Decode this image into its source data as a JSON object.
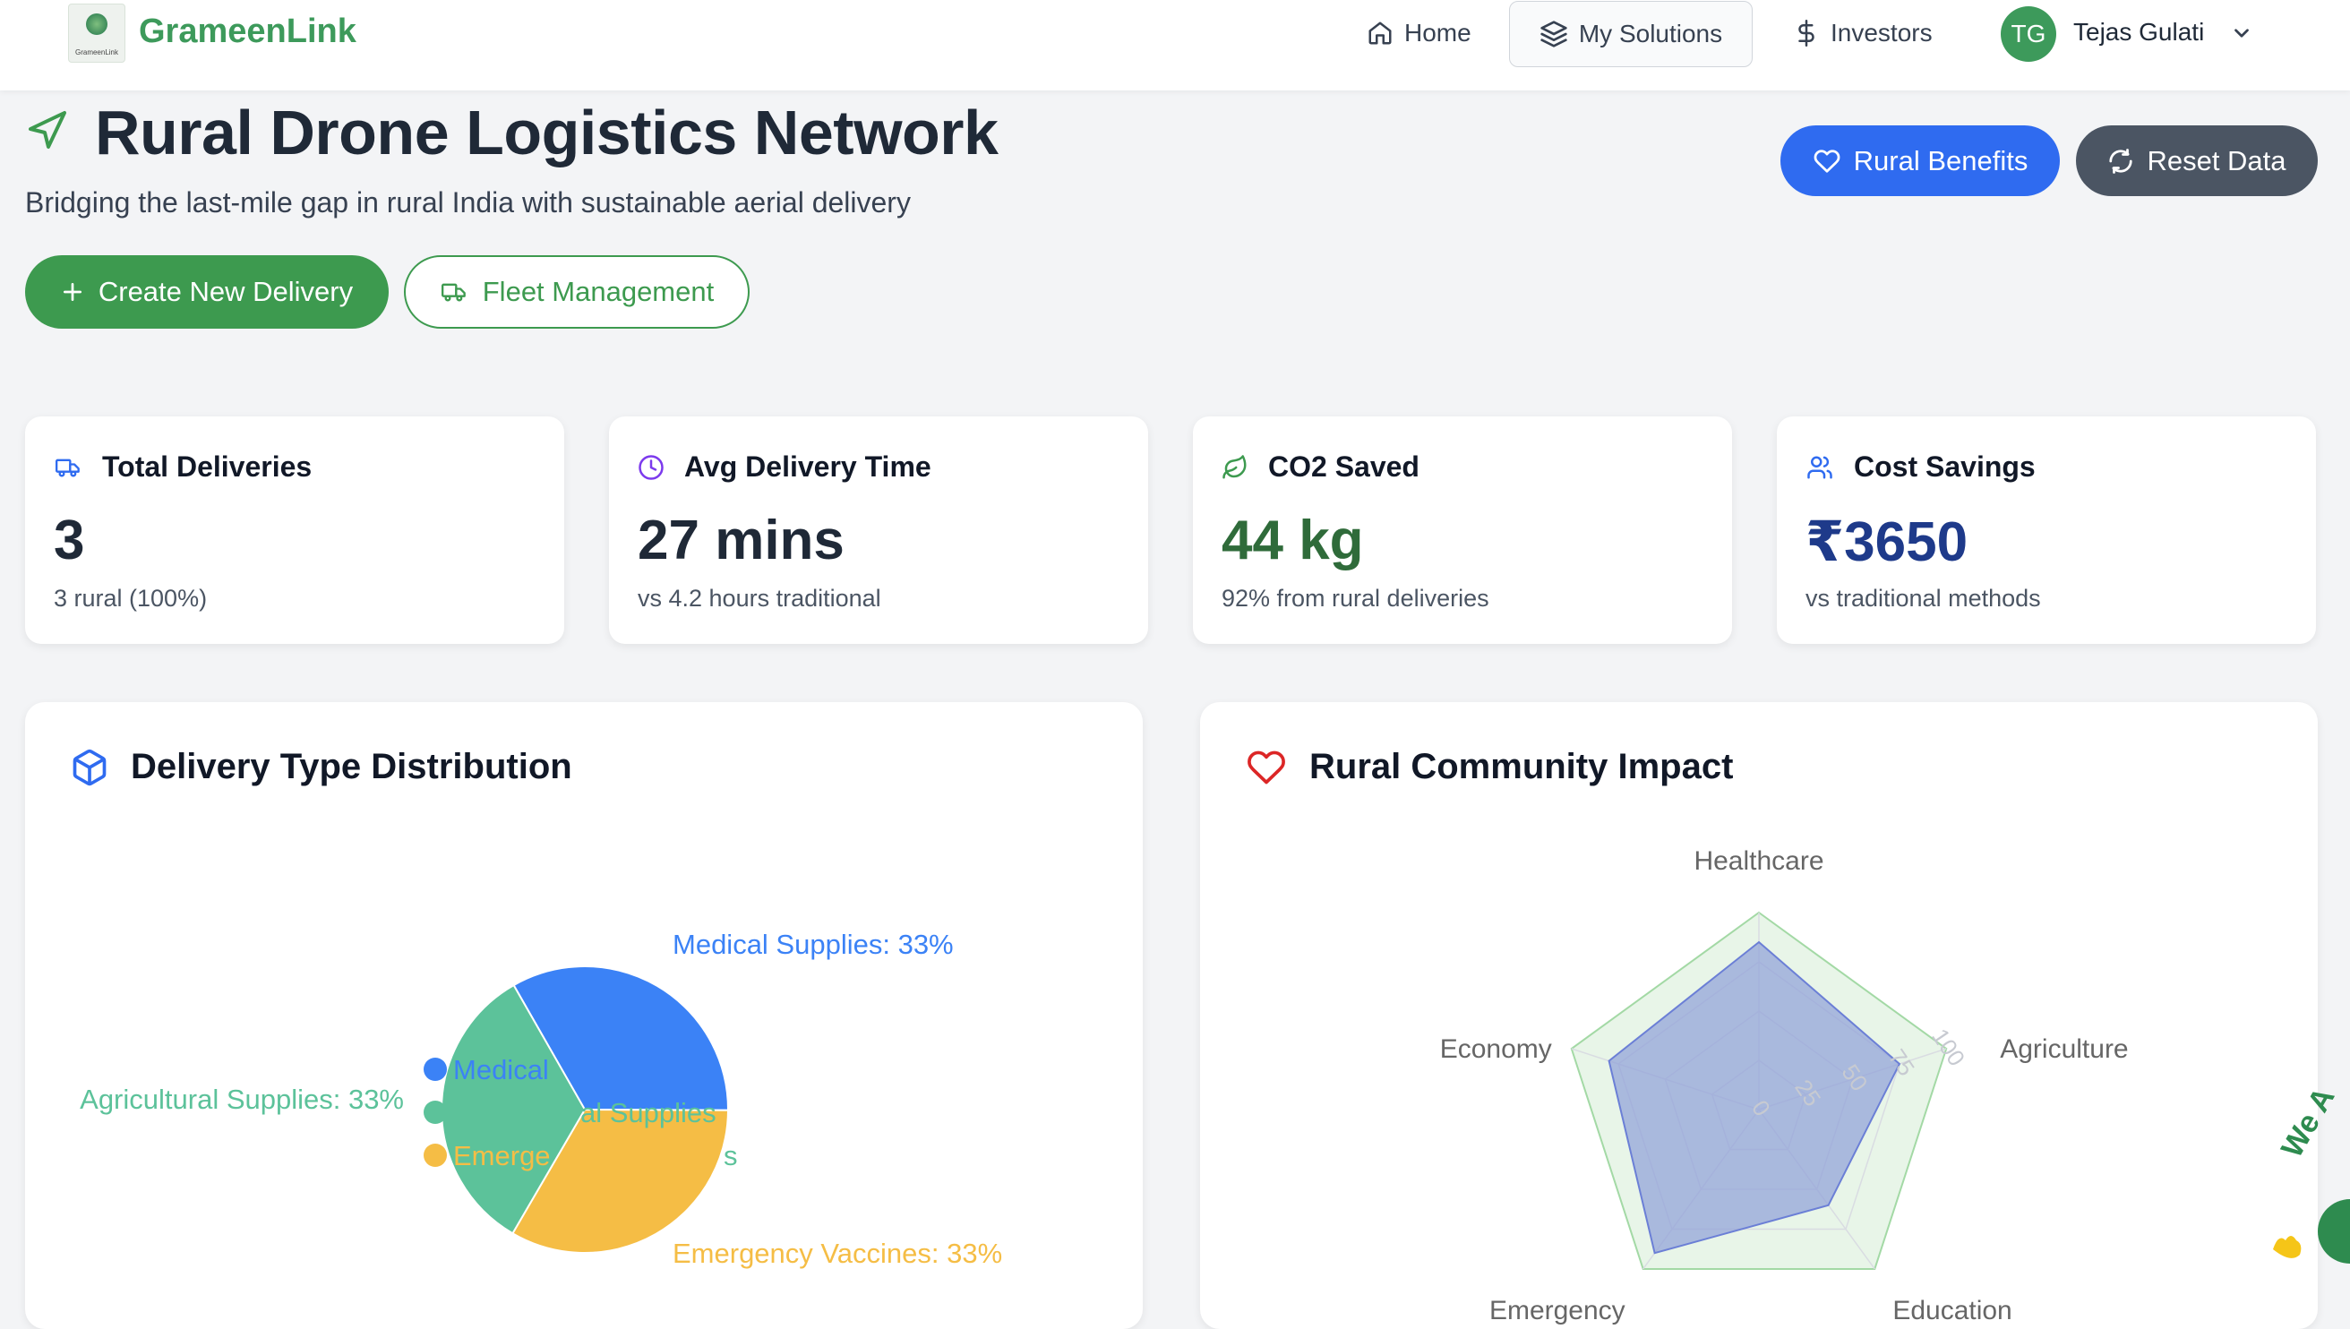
{
  "header": {
    "brand": "GrameenLink",
    "logo_caption": "GrameenLink",
    "nav": [
      {
        "label": "Home",
        "icon": "home-icon"
      },
      {
        "label": "My Solutions",
        "icon": "layers-icon"
      },
      {
        "label": "Investors",
        "icon": "dollar-icon"
      }
    ],
    "user": {
      "initials": "TG",
      "name": "Tejas Gulati"
    }
  },
  "page": {
    "title": "Rural Drone Logistics Network",
    "subtitle": "Bridging the last-mile gap in rural India with sustainable aerial delivery",
    "actions": {
      "create_delivery": "Create New Delivery",
      "fleet_management": "Fleet Management",
      "rural_benefits": "Rural Benefits",
      "reset_data": "Reset Data"
    }
  },
  "stats": [
    {
      "title": "Total Deliveries",
      "value": "3",
      "sub": "3 rural (100%)",
      "icon": "truck-icon",
      "color": "#1f2937",
      "icon_color": "#2f6bf0"
    },
    {
      "title": "Avg Delivery Time",
      "value": "27 mins",
      "sub": "vs 4.2 hours traditional",
      "icon": "clock-icon",
      "color": "#1f2937",
      "icon_color": "#7c3aed"
    },
    {
      "title": "CO2 Saved",
      "value": "44 kg",
      "sub": "92% from rural deliveries",
      "icon": "leaf-icon",
      "color": "#2f6b3a",
      "icon_color": "#3d9a4f"
    },
    {
      "title": "Cost Savings",
      "value": "₹3650",
      "sub": "vs traditional methods",
      "icon": "users-icon",
      "color": "#1e3a8a",
      "icon_color": "#2f6bf0"
    }
  ],
  "panels": {
    "distribution_title": "Delivery Type Distribution",
    "impact_title": "Rural Community Impact"
  },
  "colors": {
    "green": "#3d9a4f",
    "blue": "#2f6bf0",
    "pie_blue": "#3b82f6",
    "pie_teal": "#5cc29a",
    "pie_yellow": "#f5bd45",
    "radar_fill": "#8f9fd8",
    "radar_outer": "#a3d9a5"
  },
  "chart_data": [
    {
      "type": "pie",
      "title": "",
      "slices": [
        {
          "label": "Medical Supplies",
          "value": 33,
          "color": "#3b82f6"
        },
        {
          "label": "Emergency Vaccines",
          "value": 33,
          "color": "#f5bd45"
        },
        {
          "label": "Agricultural Supplies",
          "value": 33,
          "color": "#5cc29a"
        }
      ],
      "data_labels": [
        "Medical Supplies: 33%",
        "Emergency Vaccines: 33%",
        "Agricultural Supplies: 33%"
      ],
      "legend": [
        {
          "label": "Medical",
          "color": "#3b82f6"
        },
        {
          "label": "",
          "color": "#5cc29a"
        },
        {
          "label": "Emerge",
          "color": "#f5bd45"
        }
      ],
      "overlay_texts": [
        "al Supplies",
        "s"
      ]
    },
    {
      "type": "radar",
      "title": "",
      "axes": [
        "Healthcare",
        "Agriculture",
        "Education",
        "Emergency",
        "Economy"
      ],
      "rmax": 100,
      "ticks": [
        0,
        25,
        50,
        75,
        100
      ],
      "series": [
        {
          "name": "",
          "values": [
            85,
            75,
            60,
            90,
            80
          ],
          "color": "#8f9fd8"
        },
        {
          "name": "",
          "values": [
            100,
            100,
            100,
            100,
            100
          ],
          "color": "#a3d9a5"
        }
      ]
    }
  ],
  "fab": {
    "label": "We A"
  }
}
